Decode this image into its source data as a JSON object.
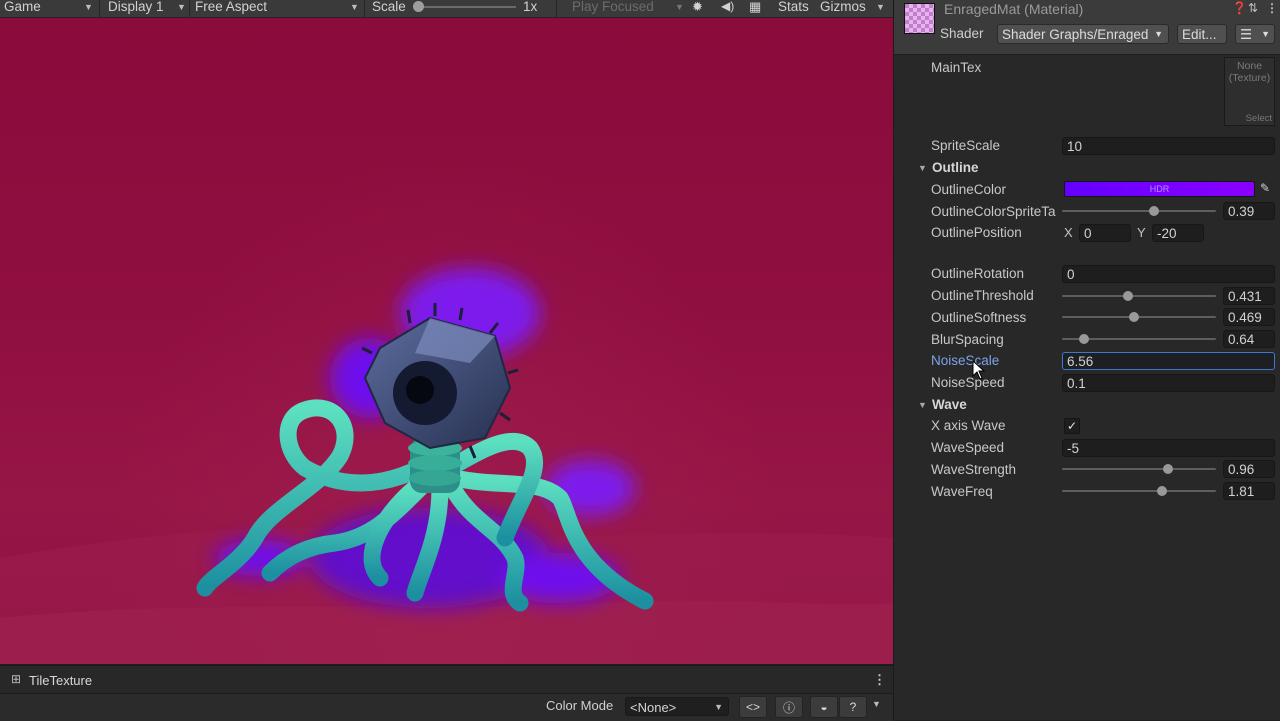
{
  "game_toolbar": {
    "view_label": "Game",
    "display_label": "Display 1",
    "aspect_label": "Free Aspect",
    "scale_label": "Scale",
    "scale_value": "1x",
    "play_mode_label": "Play Focused",
    "stats_label": "Stats",
    "gizmos_label": "Gizmos"
  },
  "bottom_tab": {
    "label": "TileTexture"
  },
  "bottom_bar": {
    "color_mode_label": "Color Mode",
    "color_mode_value": "<None>"
  },
  "inspector": {
    "title": "EnragedMat (Material)",
    "shader_label": "Shader",
    "shader_value": "Shader Graphs/Enraged",
    "edit_button": "Edit...",
    "maintex_label": "MainTex",
    "maintex_slot": {
      "line1": "None",
      "line2": "(Texture)",
      "select": "Select"
    },
    "sprite_scale": {
      "label": "SpriteScale",
      "value": "10"
    },
    "outline_section": "Outline",
    "outline_color": {
      "label": "OutlineColor",
      "tag": "HDR",
      "color": "#7000ff"
    },
    "outline_color_sprite": {
      "label": "OutlineColorSpriteTa",
      "value": "0.39",
      "level": 0.6
    },
    "outline_position": {
      "label": "OutlinePosition",
      "x_label": "X",
      "x_value": "0",
      "y_label": "Y",
      "y_value": "-20"
    },
    "outline_rotation": {
      "label": "OutlineRotation",
      "value": "0"
    },
    "outline_threshold": {
      "label": "OutlineThreshold",
      "value": "0.431",
      "level": 0.43
    },
    "outline_softness": {
      "label": "OutlineSoftness",
      "value": "0.469",
      "level": 0.47
    },
    "blur_spacing": {
      "label": "BlurSpacing",
      "value": "0.64",
      "level": 0.14
    },
    "noise_scale": {
      "label": "NoiseScale",
      "value": "6.56"
    },
    "noise_speed": {
      "label": "NoiseSpeed",
      "value": "0.1"
    },
    "wave_section": "Wave",
    "x_axis_wave": {
      "label": "X axis Wave",
      "checked": true,
      "mark": "✓"
    },
    "wave_speed": {
      "label": "WaveSpeed",
      "value": "-5"
    },
    "wave_strength": {
      "label": "WaveStrength",
      "value": "0.96",
      "level": 0.69
    },
    "wave_freq": {
      "label": "WaveFreq",
      "value": "1.81",
      "level": 0.65
    }
  },
  "colors": {
    "viewport_background": "#8c0f40",
    "creature_tentacles": "#2fb8a0",
    "creature_head": "#3b4a78",
    "outline_glow": "#7a1cff",
    "focus_accent": "#3a79d0"
  }
}
